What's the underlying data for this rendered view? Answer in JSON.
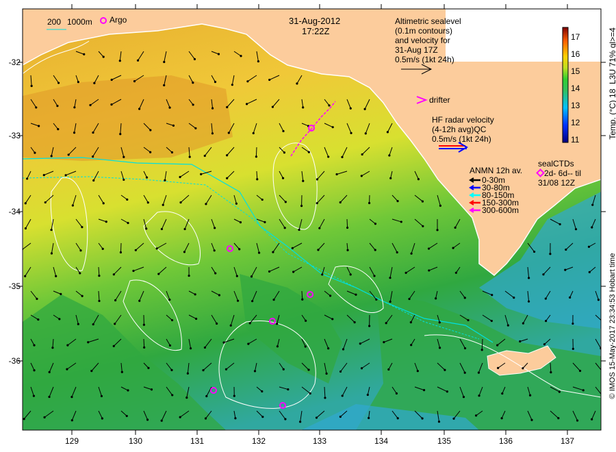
{
  "title": {
    "date": "31-Aug-2012",
    "time": "17:22Z"
  },
  "legend_top_left": {
    "depth_200": "200",
    "depth_1000": "1000m",
    "argo_label": "Argo"
  },
  "altimetry_legend": {
    "lines": [
      "Altimetric sealevel",
      "(0.1m contours)",
      "and velocity for",
      "31-Aug 17Z",
      "0.5m/s (1kt 24h)"
    ]
  },
  "drifter_legend": {
    "label": "drifter"
  },
  "hf_radar_legend": {
    "lines": [
      "HF radar velocity",
      "(4-12h avg)QC",
      "0.5m/s (1kt 24h)"
    ]
  },
  "anmn_legend": {
    "title": "ANMN 12h av.",
    "items": [
      {
        "label": "0-30m",
        "color": "#000000"
      },
      {
        "label": "30-80m",
        "color": "#0000ff"
      },
      {
        "label": "80-150m",
        "color": "#00ffff"
      },
      {
        "label": "150-300m",
        "color": "#ff0000"
      },
      {
        "label": "300-600m",
        "color": "#ff00ff"
      }
    ]
  },
  "sealctd_legend": {
    "title": "sealCTDs",
    "line1": "2d- 6d-- til",
    "line2": "31/08 12Z"
  },
  "colorbar": {
    "label": "Temp. (°C) 18_L3U 71% ql>=4",
    "ticks": [
      "17",
      "16",
      "15",
      "14",
      "13",
      "12",
      "11"
    ],
    "min": 11,
    "max": 17.6
  },
  "axes": {
    "lon_ticks": [
      "129",
      "130",
      "131",
      "132",
      "133",
      "134",
      "135",
      "136",
      "137"
    ],
    "lat_ticks": [
      "-32",
      "-33",
      "-34",
      "-35",
      "-36"
    ]
  },
  "copyright": "© IMOS 15-May-2017 23:34:53 Hobart time",
  "colors": {
    "land": "#fccc9c",
    "argo": "#ff00ff",
    "contour": "#ffffff",
    "depth200": "#00e0e0"
  }
}
